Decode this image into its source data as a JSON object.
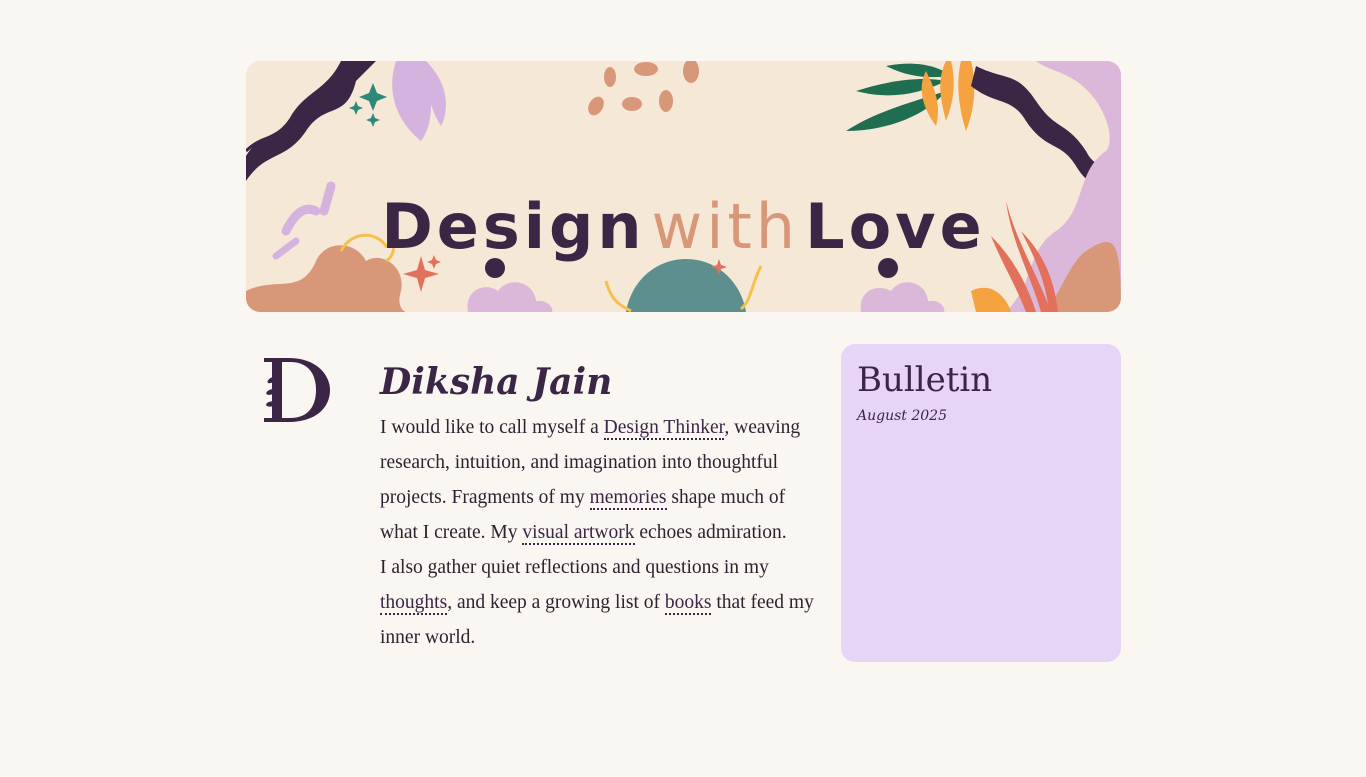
{
  "banner": {
    "title_part1": "Design",
    "title_part2": "with",
    "title_part3": "Love"
  },
  "monogram": {
    "letter": "D"
  },
  "profile": {
    "name": "Diksha Jain",
    "bio": {
      "t1": "I would like to call myself a ",
      "link_design_thinker": "Design Thinker",
      "t2": ", weaving research, intuition, and imagination into thoughtful projects. Fragments of my ",
      "link_memories": "memories",
      "t3": " shape much of what I create. My ",
      "link_visual_artwork": "visual artwork",
      "t4": " echoes admiration.",
      "t5": "I also gather quiet reflections and questions in my ",
      "link_thoughts": "thoughts",
      "t6": ", and keep a growing list of ",
      "link_books": "books",
      "t7": " that feed my inner world."
    }
  },
  "bulletin": {
    "title": "Bulletin",
    "date": "August 2025"
  },
  "colors": {
    "background": "#faf6f1",
    "primary": "#3c2646",
    "accent_peach": "#d9977a",
    "bulletin_bg": "#e6d5f6"
  }
}
